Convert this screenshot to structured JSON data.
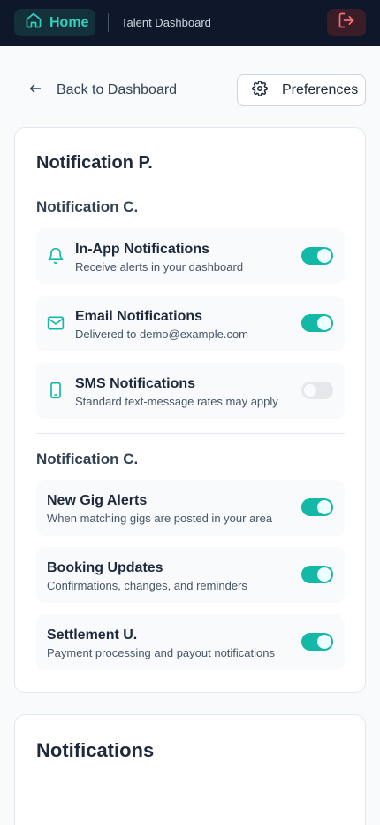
{
  "header": {
    "home_label": "Home",
    "title": "Talent Dashboard",
    "icons": {
      "home": "home-icon",
      "logout": "logout-icon"
    },
    "colors": {
      "bar": "#0f172a",
      "accent": "#2dd4bf",
      "logout": "#f87171"
    }
  },
  "nav": {
    "back_label": "Back to Dashboard",
    "preferences_label": "Preferences"
  },
  "preferences_card": {
    "title": "Notification P.",
    "channels": {
      "title": "Notification C.",
      "items": [
        {
          "icon": "bell-icon",
          "label": "In-App Notifications",
          "description": "Receive alerts in your dashboard",
          "enabled": true
        },
        {
          "icon": "mail-icon",
          "label": "Email Notifications",
          "description": "Delivered to demo@example.com",
          "enabled": true
        },
        {
          "icon": "phone-icon",
          "label": "SMS Notifications",
          "description": "Standard text-message rates may apply",
          "enabled": false
        }
      ]
    },
    "categories": {
      "title": "Notification C.",
      "items": [
        {
          "label": "New Gig Alerts",
          "description": "When matching gigs are posted in your area",
          "enabled": true
        },
        {
          "label": "Booking Updates",
          "description": "Confirmations, changes, and reminders",
          "enabled": true
        },
        {
          "label": "Settlement U.",
          "description": "Payment processing and payout notifications",
          "enabled": true
        }
      ]
    }
  },
  "notifications_card": {
    "title": "Notifications"
  }
}
